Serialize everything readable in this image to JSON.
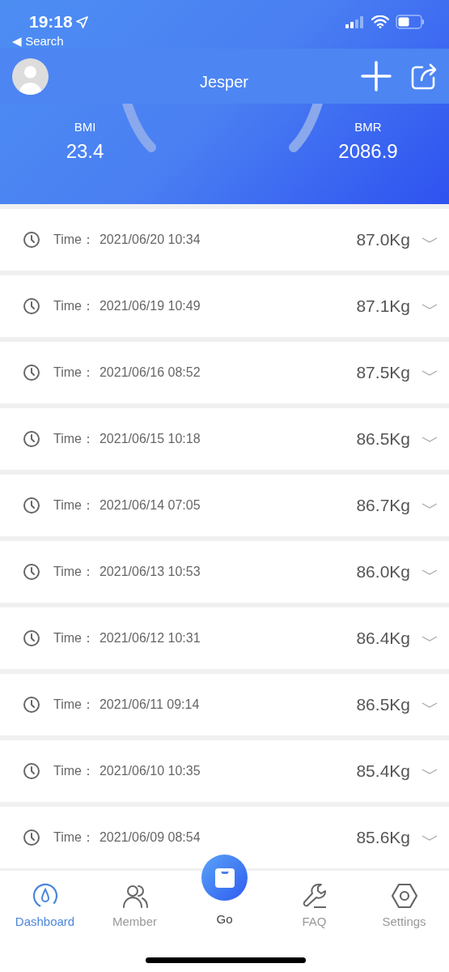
{
  "status_bar": {
    "time": "19:18"
  },
  "back_link": "◀ Search",
  "header": {
    "user_name": "Jesper",
    "stats": [
      {
        "label": "BMI",
        "value": "23.4"
      },
      {
        "label": "BMR",
        "value": "2086.9"
      }
    ]
  },
  "records": [
    {
      "label": "Time：",
      "time": "2021/06/20 10:34",
      "weight": "87.0Kg",
      "expanded": false
    },
    {
      "label": "Time：",
      "time": "2021/06/19 10:49",
      "weight": "87.1Kg",
      "expanded": false
    },
    {
      "label": "Time：",
      "time": "2021/06/16 08:52",
      "weight": "87.5Kg",
      "expanded": false
    },
    {
      "label": "Time：",
      "time": "2021/06/15 10:18",
      "weight": "86.5Kg",
      "expanded": false
    },
    {
      "label": "Time：",
      "time": "2021/06/14 07:05",
      "weight": "86.7Kg",
      "expanded": false
    },
    {
      "label": "Time：",
      "time": "2021/06/13 10:53",
      "weight": "86.0Kg",
      "expanded": false
    },
    {
      "label": "Time：",
      "time": "2021/06/12 10:31",
      "weight": "86.4Kg",
      "expanded": false
    },
    {
      "label": "Time：",
      "time": "2021/06/11 09:14",
      "weight": "86.5Kg",
      "expanded": false
    },
    {
      "label": "Time：",
      "time": "2021/06/10 10:35",
      "weight": "85.4Kg",
      "expanded": false
    },
    {
      "label": "Time：",
      "time": "2021/06/09 08:54",
      "weight": "85.6Kg",
      "expanded": false
    }
  ],
  "tab_bar": [
    {
      "kind": "dashboard",
      "label": "Dashboard",
      "selected": true
    },
    {
      "kind": "member",
      "label": "Member",
      "selected": false
    },
    {
      "kind": "go",
      "label": "Go",
      "selected": false
    },
    {
      "kind": "faq",
      "label": "FAQ",
      "selected": false
    },
    {
      "kind": "settings",
      "label": "Settings",
      "selected": false
    }
  ]
}
